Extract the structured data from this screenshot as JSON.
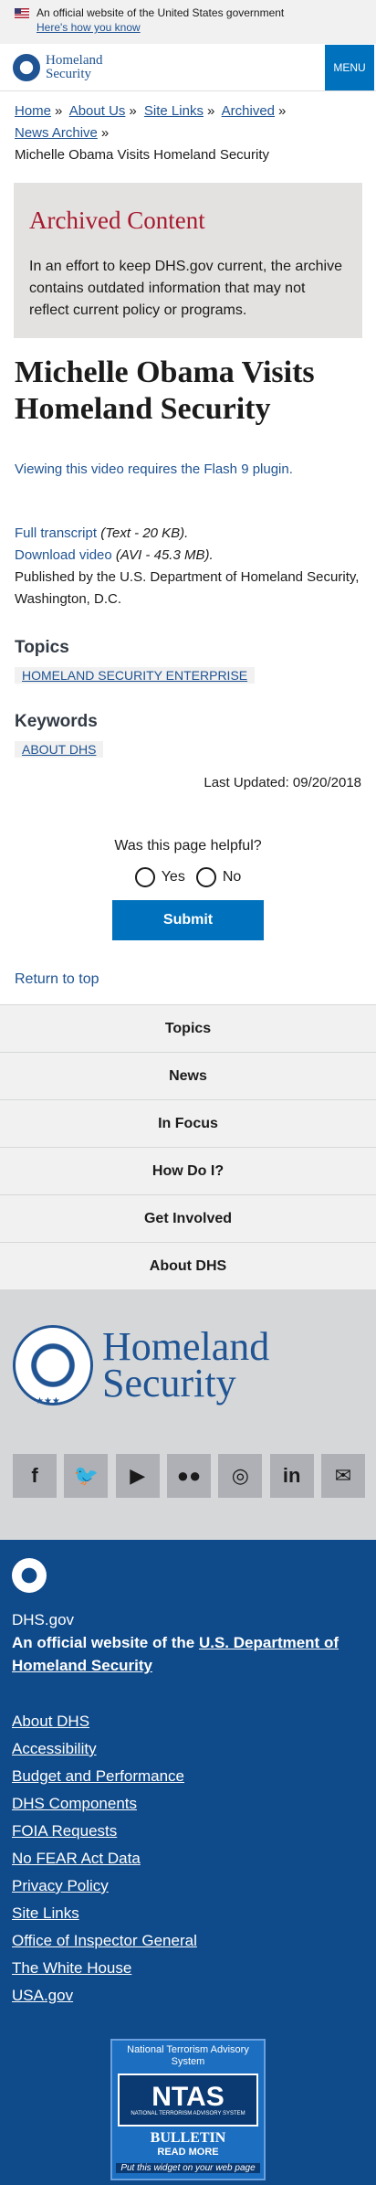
{
  "gov_banner": {
    "text": "An official website of the United States government",
    "howto": "Here's how you know"
  },
  "header": {
    "logo_line1": "Homeland",
    "logo_line2": "Security",
    "menu": "MENU"
  },
  "breadcrumb": {
    "home": "Home",
    "about": "About Us",
    "sitelinks": "Site Links",
    "archived": "Archived",
    "news": "News Archive",
    "current": "Michelle Obama Visits Homeland Security",
    "sep": "»"
  },
  "archived": {
    "title": "Archived Content",
    "text": "In an effort to keep DHS.gov current, the archive contains outdated information that may not reflect current policy or programs."
  },
  "title": "Michelle Obama Visits Homeland Security",
  "flash_link": "Viewing this video requires the Flash 9 plugin.",
  "files": {
    "transcript_link": "Full transcript",
    "transcript_meta": "(Text - 20 KB).",
    "video_link": "Download video",
    "video_meta": "(AVI - 45.3 MB).",
    "published": "Published by the U.S. Department of Homeland Security, Washington, D.C."
  },
  "topics": {
    "label": "Topics",
    "tag": "HOMELAND SECURITY ENTERPRISE"
  },
  "keywords": {
    "label": "Keywords",
    "tag": "ABOUT DHS"
  },
  "last_updated": "Last Updated: 09/20/2018",
  "feedback": {
    "question": "Was this page helpful?",
    "yes": "Yes",
    "no": "No",
    "submit": "Submit"
  },
  "return_top": "Return to top",
  "footer_nav": [
    "Topics",
    "News",
    "In Focus",
    "How Do I?",
    "Get Involved",
    "About DHS"
  ],
  "footer_logo": {
    "line1": "Homeland",
    "line2": "Security"
  },
  "social": [
    {
      "label": "f",
      "icon": "facebook-icon"
    },
    {
      "label": "🐦",
      "icon": "twitter-icon"
    },
    {
      "label": "▶",
      "icon": "youtube-icon"
    },
    {
      "label": "●●",
      "icon": "flickr-icon"
    },
    {
      "label": "◎",
      "icon": "instagram-icon"
    },
    {
      "label": "in",
      "icon": "linkedin-icon"
    },
    {
      "label": "✉",
      "icon": "email-icon"
    }
  ],
  "blue_footer": {
    "site": "DHS.gov",
    "official_prefix": "An official website of the ",
    "official_link": "U.S. Department of Homeland Security",
    "links": [
      "About DHS",
      "Accessibility",
      "Budget and Performance",
      "DHS Components",
      "FOIA Requests",
      "No FEAR Act Data",
      "Privacy Policy",
      "Site Links",
      "Office of Inspector General",
      "The White House",
      "USA.gov"
    ]
  },
  "ntas": {
    "line1": "National Terrorism Advisory System",
    "big": "NTAS",
    "small": "NATIONAL TERRORISM ADVISORY SYSTEM",
    "bulletin": "BULLETIN",
    "read_more": "READ MORE",
    "widget": "Put this widget on your web page"
  }
}
